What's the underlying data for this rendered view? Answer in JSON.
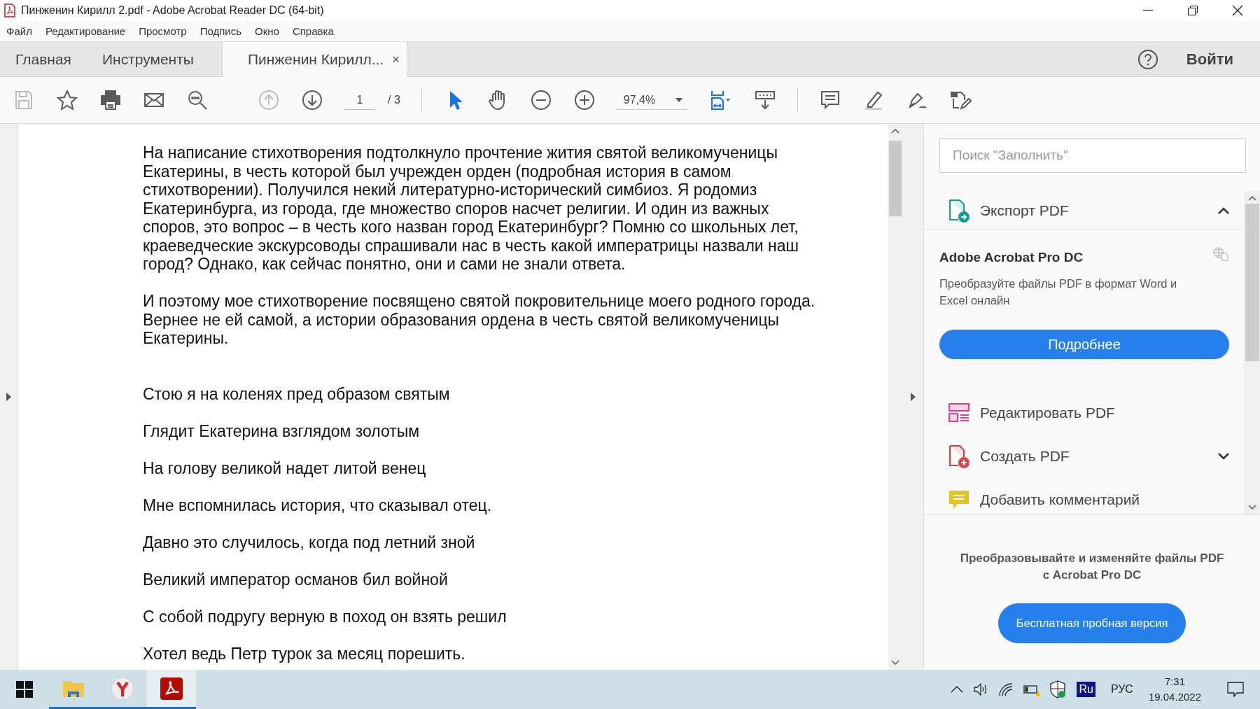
{
  "window": {
    "title": "Пинженин Кирилл 2.pdf - Adobe Acrobat Reader DC (64-bit)"
  },
  "menu": [
    "Файл",
    "Редактирование",
    "Просмотр",
    "Подпись",
    "Окно",
    "Справка"
  ],
  "tabs": [
    {
      "label": "Главная",
      "selected": false
    },
    {
      "label": "Инструменты",
      "selected": false
    },
    {
      "label": "Пинженин Кирилл...",
      "selected": true,
      "close": "×"
    }
  ],
  "account": {
    "sign_in": "Войти"
  },
  "toolbar": {
    "groups": [
      [
        {
          "kind": "save",
          "disabled": true
        },
        {
          "kind": "bookmark",
          "disabled": false
        },
        {
          "kind": "print",
          "disabled": false
        },
        {
          "kind": "email",
          "disabled": false
        },
        {
          "kind": "find",
          "disabled": false
        }
      ],
      [
        {
          "kind": "prev-page",
          "disabled": true
        },
        {
          "kind": "next-page",
          "disabled": false
        },
        {
          "kind": "page",
          "value": "1",
          "total": "/ 3"
        }
      ],
      [
        {
          "kind": "select",
          "selected": true
        },
        {
          "kind": "hand",
          "selected": false
        },
        {
          "kind": "zoom-out",
          "disabled": false
        },
        {
          "kind": "zoom-in",
          "disabled": false
        },
        {
          "kind": "zoom",
          "value": "97,4%"
        },
        {
          "kind": "fit"
        },
        {
          "kind": "scroll-mode",
          "disabled": false
        }
      ],
      [
        {
          "kind": "comment",
          "disabled": false
        },
        {
          "kind": "highlight",
          "disabled": false
        },
        {
          "kind": "sign",
          "disabled": false
        },
        {
          "kind": "edit",
          "disabled": false
        }
      ]
    ]
  },
  "document": {
    "paragraphs": [
      {
        "lines": [
          "На написание стихотворения подтолкнуло прочтение жития святой великомученицы",
          "Екатерины, в честь которой был учрежден орден (подробная история в самом",
          "стихотворении). Получился некий литературно-исторический симбиоз.   Я родомиз",
          "Екатеринбурга, из города, где множество споров насчет религии.  И один из важных",
          "споров, это вопрос – в честь кого назван город Екатеринбург? Помню со школьных лет,",
          "краеведческие экскурсоводы спрашивали нас в честь какой императрицы назвали наш",
          "город? Однако, как сейчас понятно, они и сами не знали ответа."
        ]
      },
      {
        "lines": [
          "И поэтому мое стихотворение посвящено святой покровительнице моего родного города.",
          "Вернее не ей самой, а истории образования ордена в честь святой великомученицы",
          "Екатерины."
        ]
      }
    ],
    "verses": [
      "Стою я на коленях пред образом святым",
      "Глядит Екатерина взглядом золотым",
      "На голову великой надет литой венец",
      "Мне вспомнилась история, что сказывал отец.",
      "Давно это случилось, когда под летний зной",
      "Великий император османов бил войной",
      "С собой подругу верную в поход он взять решил",
      "Хотел ведь Петр турок за месяц порешить."
    ]
  },
  "right_panel": {
    "search": {
      "placeholder": "Поиск \"Заполнить\""
    },
    "export": {
      "label": "Экспорт PDF",
      "expanded": true,
      "card_title": "Adobe Acrobat Pro DC",
      "description": "Преобразуйте файлы PDF в формат Word и Excel онлайн",
      "button": "Подробнее"
    },
    "tools": [
      {
        "kind": "edit",
        "label": "Редактировать PDF"
      },
      {
        "kind": "create",
        "label": "Создать PDF",
        "expanded": false
      },
      {
        "kind": "comment",
        "label": "Добавить комментарий"
      }
    ],
    "promo": "Преобразовывайте и изменяйте файлы PDF с Acrobat Pro DC",
    "trial_button": "Бесплатная пробная версия"
  },
  "taskbar": {
    "apps": [
      {
        "kind": "start",
        "open": false,
        "selected": false
      },
      {
        "kind": "explorer",
        "open": true,
        "selected": false
      },
      {
        "kind": "browser",
        "open": true,
        "selected": false
      },
      {
        "kind": "acrobat",
        "open": true,
        "selected": true
      }
    ],
    "ime": "Ru",
    "language": "РУС",
    "time": "7:31",
    "date": "19.04.2022"
  }
}
